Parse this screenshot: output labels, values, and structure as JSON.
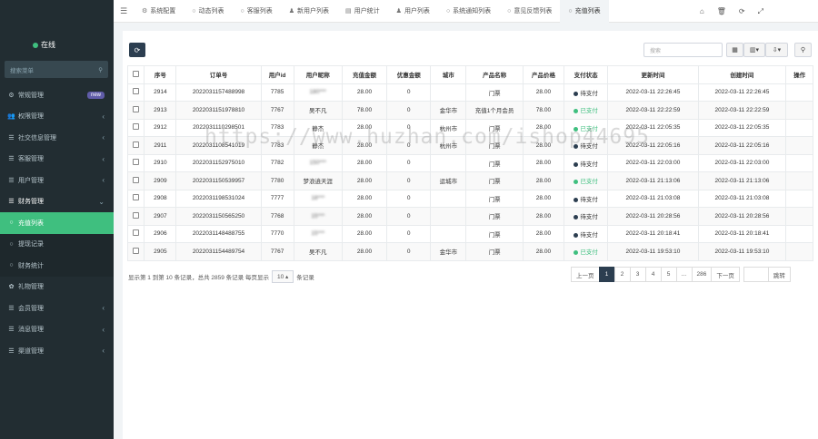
{
  "sidebar": {
    "status": "在线",
    "search_placeholder": "搜索菜单",
    "items": [
      {
        "label": "常规管理",
        "icon": "gear-icon",
        "glyph": "⚙",
        "badge": "new"
      },
      {
        "label": "权限管理",
        "icon": "group-icon",
        "glyph": "👥",
        "chev": "‹"
      },
      {
        "label": "社交信息管理",
        "icon": "list-icon",
        "glyph": "☰",
        "chev": "‹"
      },
      {
        "label": "客服管理",
        "icon": "list-icon",
        "glyph": "☰",
        "chev": "‹"
      },
      {
        "label": "用户管理",
        "icon": "list-icon",
        "glyph": "☰",
        "chev": "‹"
      },
      {
        "label": "财务管理",
        "icon": "list-icon",
        "glyph": "☰",
        "chev": "⌄"
      },
      {
        "label": "充值列表",
        "icon": "circle-icon",
        "glyph": "○"
      },
      {
        "label": "提现记录",
        "icon": "circle-icon",
        "glyph": "○"
      },
      {
        "label": "财务统计",
        "icon": "circle-icon",
        "glyph": "○"
      },
      {
        "label": "礼物管理",
        "icon": "gift-icon",
        "glyph": "✿"
      },
      {
        "label": "会员管理",
        "icon": "list-icon",
        "glyph": "☰",
        "chev": "‹"
      },
      {
        "label": "消息管理",
        "icon": "list-icon",
        "glyph": "☰",
        "chev": "‹"
      },
      {
        "label": "渠道管理",
        "icon": "list-icon",
        "glyph": "☰",
        "chev": "‹"
      }
    ]
  },
  "tabs": [
    {
      "label": "系统配置",
      "glyph": "⚙"
    },
    {
      "label": "动态列表",
      "glyph": "○"
    },
    {
      "label": "客服列表",
      "glyph": "○"
    },
    {
      "label": "新用户列表",
      "glyph": "♟"
    },
    {
      "label": "用户统计",
      "glyph": "▤"
    },
    {
      "label": "用户列表",
      "glyph": "♟"
    },
    {
      "label": "系统通知列表",
      "glyph": "○"
    },
    {
      "label": "意见反馈列表",
      "glyph": "○"
    },
    {
      "label": "充值列表",
      "glyph": "○"
    }
  ],
  "toolbar": {
    "search_placeholder": "搜索"
  },
  "table": {
    "headers": [
      "序号",
      "订单号",
      "用户id",
      "用户昵称",
      "充值金额",
      "优惠金额",
      "城市",
      "产品名称",
      "产品价格",
      "支付状态",
      "更新时间",
      "创建时间",
      "操作"
    ],
    "rows": [
      [
        "2914",
        "2022031157488998",
        "7785",
        "180***",
        "28.00",
        "0",
        "",
        "门票",
        "28.00",
        "待支付",
        "2022-03-11 22:26:45",
        "2022-03-11 22:26:45"
      ],
      [
        "2913",
        "2022031151978810",
        "7767",
        "吴不凡",
        "78.00",
        "0",
        "金华市",
        "充值1个月会员",
        "78.00",
        "已支付",
        "2022-03-11 22:22:59",
        "2022-03-11 22:22:59"
      ],
      [
        "2912",
        "2022031110298501",
        "7783",
        "静杰",
        "28.00",
        "0",
        "杭州市",
        "门票",
        "28.00",
        "已支付",
        "2022-03-11 22:05:35",
        "2022-03-11 22:05:35"
      ],
      [
        "2911",
        "2022031108541019",
        "7783",
        "静杰",
        "28.00",
        "0",
        "杭州市",
        "门票",
        "28.00",
        "待支付",
        "2022-03-11 22:05:16",
        "2022-03-11 22:05:16"
      ],
      [
        "2910",
        "2022031152975010",
        "7782",
        "150***",
        "28.00",
        "0",
        "",
        "门票",
        "28.00",
        "待支付",
        "2022-03-11 22:03:00",
        "2022-03-11 22:03:00"
      ],
      [
        "2909",
        "2022031150539957",
        "7780",
        "梦浪逍天涯",
        "28.00",
        "0",
        "运城市",
        "门票",
        "28.00",
        "已支付",
        "2022-03-11 21:13:06",
        "2022-03-11 21:13:06"
      ],
      [
        "2908",
        "2022031198531024",
        "7777",
        "18***",
        "28.00",
        "0",
        "",
        "门票",
        "28.00",
        "待支付",
        "2022-03-11 21:03:08",
        "2022-03-11 21:03:08"
      ],
      [
        "2907",
        "2022031150565250",
        "7768",
        "15***",
        "28.00",
        "0",
        "",
        "门票",
        "28.00",
        "待支付",
        "2022-03-11 20:28:56",
        "2022-03-11 20:28:56"
      ],
      [
        "2906",
        "2022031148488755",
        "7770",
        "15***",
        "28.00",
        "0",
        "",
        "门票",
        "28.00",
        "待支付",
        "2022-03-11 20:18:41",
        "2022-03-11 20:18:41"
      ],
      [
        "2905",
        "2022031154489754",
        "7767",
        "吴不凡",
        "28.00",
        "0",
        "金华市",
        "门票",
        "28.00",
        "已支付",
        "2022-03-11 19:53:10",
        "2022-03-11 19:53:10"
      ]
    ]
  },
  "pagination": {
    "info_prefix": "显示第 1 到第 10 条记录，总共 2859 条记录 每页显示",
    "page_size": "10 ▴",
    "info_suffix": "条记录",
    "prev": "上一页",
    "pages": [
      "1",
      "2",
      "3",
      "4",
      "5",
      "...",
      "286"
    ],
    "next": "下一页",
    "jump": "跳转"
  },
  "watermark": "https://www.huzhan.com/ishop44695"
}
